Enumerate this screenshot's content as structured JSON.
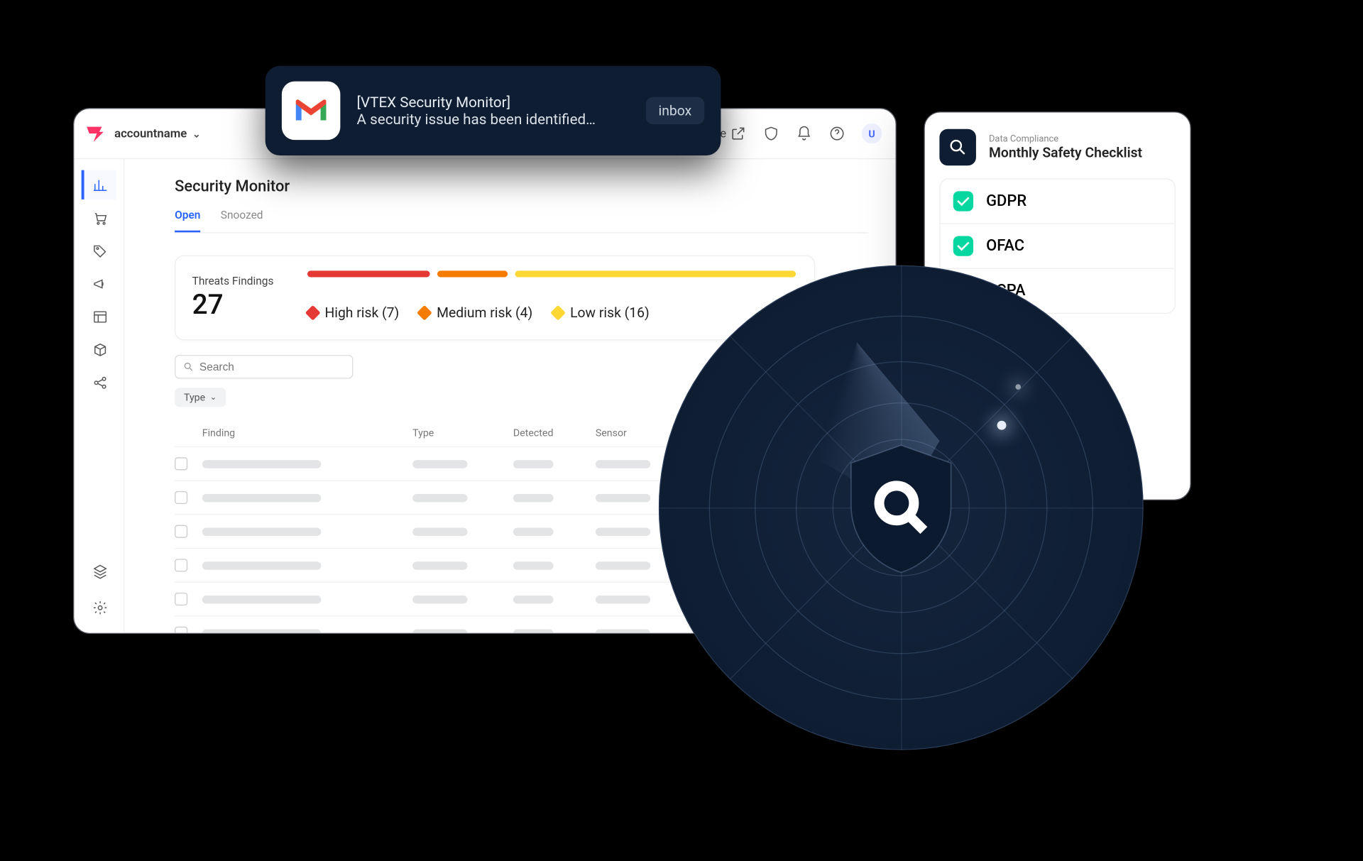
{
  "header": {
    "account_name": "accountname",
    "store_link": "…ore",
    "avatar_initial": "U"
  },
  "page_title": "Security Monitor",
  "tabs": {
    "open": "Open",
    "snoozed": "Snoozed"
  },
  "findings": {
    "label": "Threats Findings",
    "total": "27",
    "high": {
      "label": "High risk (7)",
      "count": 7
    },
    "medium": {
      "label": "Medium risk (4)",
      "count": 4
    },
    "low": {
      "label": "Low risk (16)",
      "count": 16
    }
  },
  "search_placeholder": "Search",
  "type_filter_label": "Type",
  "table_headers": {
    "finding": "Finding",
    "type": "Type",
    "detected": "Detected",
    "sensor": "Sensor"
  },
  "toast": {
    "title": "[VTEX Security Monitor]",
    "body": "A security issue has been identified…",
    "badge": "inbox"
  },
  "compliance": {
    "subtitle": "Data Compliance",
    "title": "Monthly Safety Checklist",
    "items": [
      {
        "label": "GDPR",
        "checked": true
      },
      {
        "label": "OFAC",
        "checked": true
      },
      {
        "label": "CCPA",
        "checked": false
      }
    ]
  },
  "colors": {
    "accent": "#2962ff"
  }
}
